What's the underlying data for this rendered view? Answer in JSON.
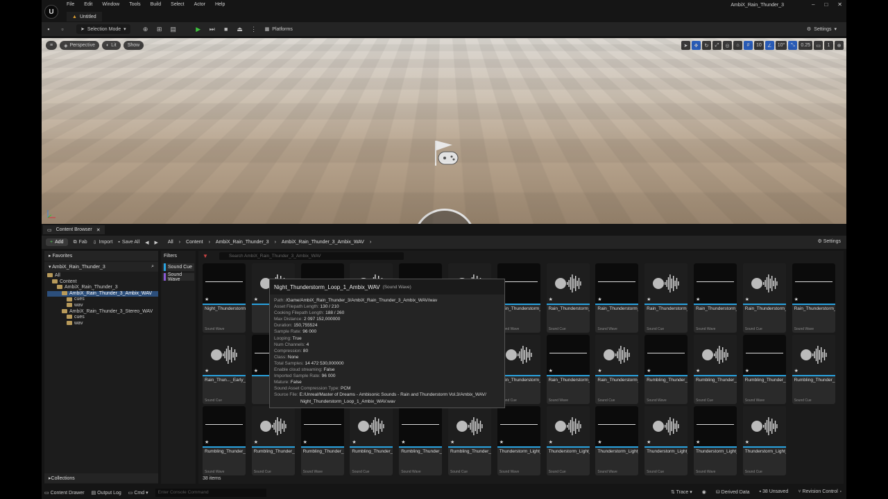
{
  "app": {
    "window_title": "AmbiX_Rain_Thunder_3",
    "doc_tab": "Untitled",
    "menu": [
      "File",
      "Edit",
      "Window",
      "Tools",
      "Build",
      "Select",
      "Actor",
      "Help"
    ]
  },
  "toolbar": {
    "selection_mode": "Selection Mode",
    "platforms": "Platforms",
    "settings": "Settings"
  },
  "viewport": {
    "perspective": "Perspective",
    "lit": "Lit",
    "show": "Show",
    "grid_snap": "10",
    "rot_snap": "10°",
    "scale_snap": "0.25",
    "cam_speed": "1"
  },
  "content_browser": {
    "tab": "Content Browser",
    "add": "Add",
    "fab": "Fab",
    "import": "Import",
    "save_all": "Save All",
    "breadcrumbs": [
      "All",
      "Content",
      "AmbiX_Rain_Thunder_3",
      "AmbiX_Rain_Thunder_3_Ambix_WAV"
    ],
    "settings": "Settings",
    "favorites": "Favorites",
    "project": "AmbiX_Rain_Thunder_3",
    "tree": [
      {
        "label": "All",
        "indent": 0,
        "sel": false
      },
      {
        "label": "Content",
        "indent": 1,
        "sel": false
      },
      {
        "label": "AmbiX_Rain_Thunder_3",
        "indent": 2,
        "sel": false
      },
      {
        "label": "AmbiX_Rain_Thunder_3_Ambix_WAV",
        "indent": 3,
        "sel": true
      },
      {
        "label": "cues",
        "indent": 4,
        "sel": false
      },
      {
        "label": "wav",
        "indent": 4,
        "sel": false
      },
      {
        "label": "AmbiX_Rain_Thunder_3_Stereo_WAV",
        "indent": 3,
        "sel": false
      },
      {
        "label": "cues",
        "indent": 4,
        "sel": false
      },
      {
        "label": "wav",
        "indent": 4,
        "sel": false
      }
    ],
    "filters_title": "Filters",
    "filters": [
      {
        "label": "Sound Cue",
        "color": "#29a3e0"
      },
      {
        "label": "Sound Wave",
        "color": "#8a5ad6"
      }
    ],
    "search_placeholder": "Search AmbiX_Rain_Thunder_3_Ambix_WAV",
    "collections": "Collections",
    "item_count": "38 items",
    "tiles": [
      {
        "name": "Night_Thunderstorm_Loop_1_Ambix",
        "type": "Sound Wave",
        "kind": "wave"
      },
      {
        "name": "",
        "type": "",
        "kind": "cue"
      },
      {
        "name": "",
        "type": "",
        "kind": "wave"
      },
      {
        "name": "",
        "type": "",
        "kind": "cue"
      },
      {
        "name": "",
        "type": "",
        "kind": "wave"
      },
      {
        "name": "Rain_Thunderstorm_Far_Away_Loop_3_Full_Ambi...",
        "type": "",
        "kind": "cue"
      },
      {
        "name": "Rain_Thunderstorm_Early_Morning_Village_Loop_1...",
        "type": "Sound Wave",
        "kind": "wave"
      },
      {
        "name": "Rain_Thunderstorm_Early_Morning_Village_Loop_1...",
        "type": "Sound Cue",
        "kind": "cue"
      },
      {
        "name": "Rain_Thunderstorm_Early_Morning_Village_Loop_2...",
        "type": "Sound Wave",
        "kind": "wave"
      },
      {
        "name": "Rain_Thunderstorm_Early_Morning_Village_Loop_2...",
        "type": "Sound Cue",
        "kind": "cue"
      },
      {
        "name": "Rain_Thunderstorm_Early_Morning_Village_Loop_3...",
        "type": "Sound Wave",
        "kind": "wave"
      },
      {
        "name": "Rain_Thunderstorm_Early_Morning_Village_Loop_3...",
        "type": "Sound Cue",
        "kind": "cue"
      },
      {
        "name": "Rain_Thunderstorm_Early_Morning_Village_Loop_Full...",
        "type": "Sound Wave",
        "kind": "wave"
      },
      {
        "name": "Rain_Thun..._Early_Mor..._Village_Lo...",
        "type": "Sound Cue",
        "kind": "cue"
      },
      {
        "name": "",
        "type": "",
        "kind": "wave"
      },
      {
        "name": "",
        "type": "",
        "kind": "cue"
      },
      {
        "name": "",
        "type": "",
        "kind": "wave"
      },
      {
        "name": "",
        "type": "",
        "kind": "cue"
      },
      {
        "name": "..understorm_Far_Away_Loop_3_...WAV",
        "type": "",
        "kind": "wave"
      },
      {
        "name": "Rain_Thunderstorm_Far_Away_Loop_3_Ambix_WAV_Cue",
        "type": "Sound Cue",
        "kind": "cue"
      },
      {
        "name": "Rain_Thunderstorm_Far_Away_Loop_Full_Ambix_WAV",
        "type": "Sound Wave",
        "kind": "wave"
      },
      {
        "name": "Rain_Thunderstorm_Far_Away_Loop_Full_Ambix_WAV_C...",
        "type": "Sound Cue",
        "kind": "cue"
      },
      {
        "name": "Rumbling_Thunder_Drizzling_Rain_Full_Ambix_WAV",
        "type": "Sound Wave",
        "kind": "wave"
      },
      {
        "name": "Rumbling_Thunder_Drizzling_Rain_Full_Ambix_WAV...",
        "type": "Sound Cue",
        "kind": "cue"
      },
      {
        "name": "Rumbling_Thunder_Drizzling_Rain_Loop_1_Ambix...",
        "type": "Sound Wave",
        "kind": "wave"
      },
      {
        "name": "Rumbling_Thunder_Drizzling_Rain_Loop_1_Ambix...",
        "type": "Sound Cue",
        "kind": "cue"
      },
      {
        "name": "Rumbling_Thunder_Drizzling_Rain_Loop_2_Ambix...",
        "type": "Sound Wave",
        "kind": "wave"
      },
      {
        "name": "Rumbling_Thunder_Drizzling_Rain_Loop_2_Ambix...",
        "type": "Sound Cue",
        "kind": "cue"
      },
      {
        "name": "Rumbling_Thunder_Drizzling_Rain_Loop_3_Ambix...",
        "type": "Sound Wave",
        "kind": "wave"
      },
      {
        "name": "Rumbling_Thunder_Drizzling_Rain_Loop_3_Ambix...",
        "type": "Sound Cue",
        "kind": "cue"
      },
      {
        "name": "Rumbling_Thunder_Drizzling_Rain_Loop_4_Ambix...",
        "type": "Sound Wave",
        "kind": "wave"
      },
      {
        "name": "Rumbling_Thunder_Drizzling_Rain_Loop_4_Ambix...",
        "type": "Sound Cue",
        "kind": "cue"
      },
      {
        "name": "Thunderstorm_Light_Rain_Loop_1_Ambix_WAV",
        "type": "Sound Wave",
        "kind": "wave"
      },
      {
        "name": "Thunderstorm_Light_Rain_Loop_1_Ambix_WAV_Cue",
        "type": "Sound Cue",
        "kind": "cue"
      },
      {
        "name": "Thunderstorm_Light_Rain_Loop_2_Ambix_WAV",
        "type": "Sound Wave",
        "kind": "wave"
      },
      {
        "name": "Thunderstorm_Light_Rain_Loop_2_Ambix_WAV_Cue",
        "type": "Sound Cue",
        "kind": "cue"
      },
      {
        "name": "Thunderstorm_Light_Rain_Loop_Full_Ambix_WAV",
        "type": "Sound Wave",
        "kind": "wave"
      },
      {
        "name": "Thunderstorm_Light_Rain_Loop_Full_Ambix_WA...",
        "type": "Sound Cue",
        "kind": "cue"
      }
    ]
  },
  "tooltip": {
    "title": "Night_Thunderstorm_Loop_1_Ambix_WAV",
    "subtitle": "(Sound Wave)",
    "rows": [
      {
        "k": "Path:",
        "v": "/Game/AmbiX_Rain_Thunder_3/AmbiX_Rain_Thunder_3_Ambix_WAV/wav"
      },
      {
        "k": "Asset Filepath Length:",
        "v": "130 / 210"
      },
      {
        "k": "Cooking Filepath Length:",
        "v": "188 / 260"
      },
      {
        "k": "Max Distance:",
        "v": "2 097 152,000000"
      },
      {
        "k": "Duration:",
        "v": "150,755524"
      },
      {
        "k": "Sample Rate:",
        "v": "96 000"
      },
      {
        "k": "Looping:",
        "v": "True"
      },
      {
        "k": "Num Channels:",
        "v": "4"
      },
      {
        "k": "Compression:",
        "v": "80"
      },
      {
        "k": "Class:",
        "v": "None"
      },
      {
        "k": "Total Samples:",
        "v": "14 472 530,000000"
      },
      {
        "k": "Enable cloud streaming:",
        "v": "False"
      },
      {
        "k": "Imported Sample Rate:",
        "v": "96 000"
      },
      {
        "k": "Mature:",
        "v": "False"
      },
      {
        "k": "Sound Asset Compression Type:",
        "v": "PCM"
      },
      {
        "k": "Source File:",
        "v": "E:/Unreal/Master of Dreams - Ambisonic Sounds - Rain and Thunderstorm Vol.3/Ambix_WAV/"
      },
      {
        "k": "",
        "v": "Night_Thunderstorm_Loop_1_Ambix_WAV.wav"
      }
    ]
  },
  "statusbar": {
    "content_drawer": "Content Drawer",
    "output_log": "Output Log",
    "cmd": "Cmd",
    "console_placeholder": "Enter Console Command",
    "trace": "Trace",
    "derived_data": "Derived Data",
    "unsaved": "38 Unsaved",
    "revision_control": "Revision Control"
  }
}
